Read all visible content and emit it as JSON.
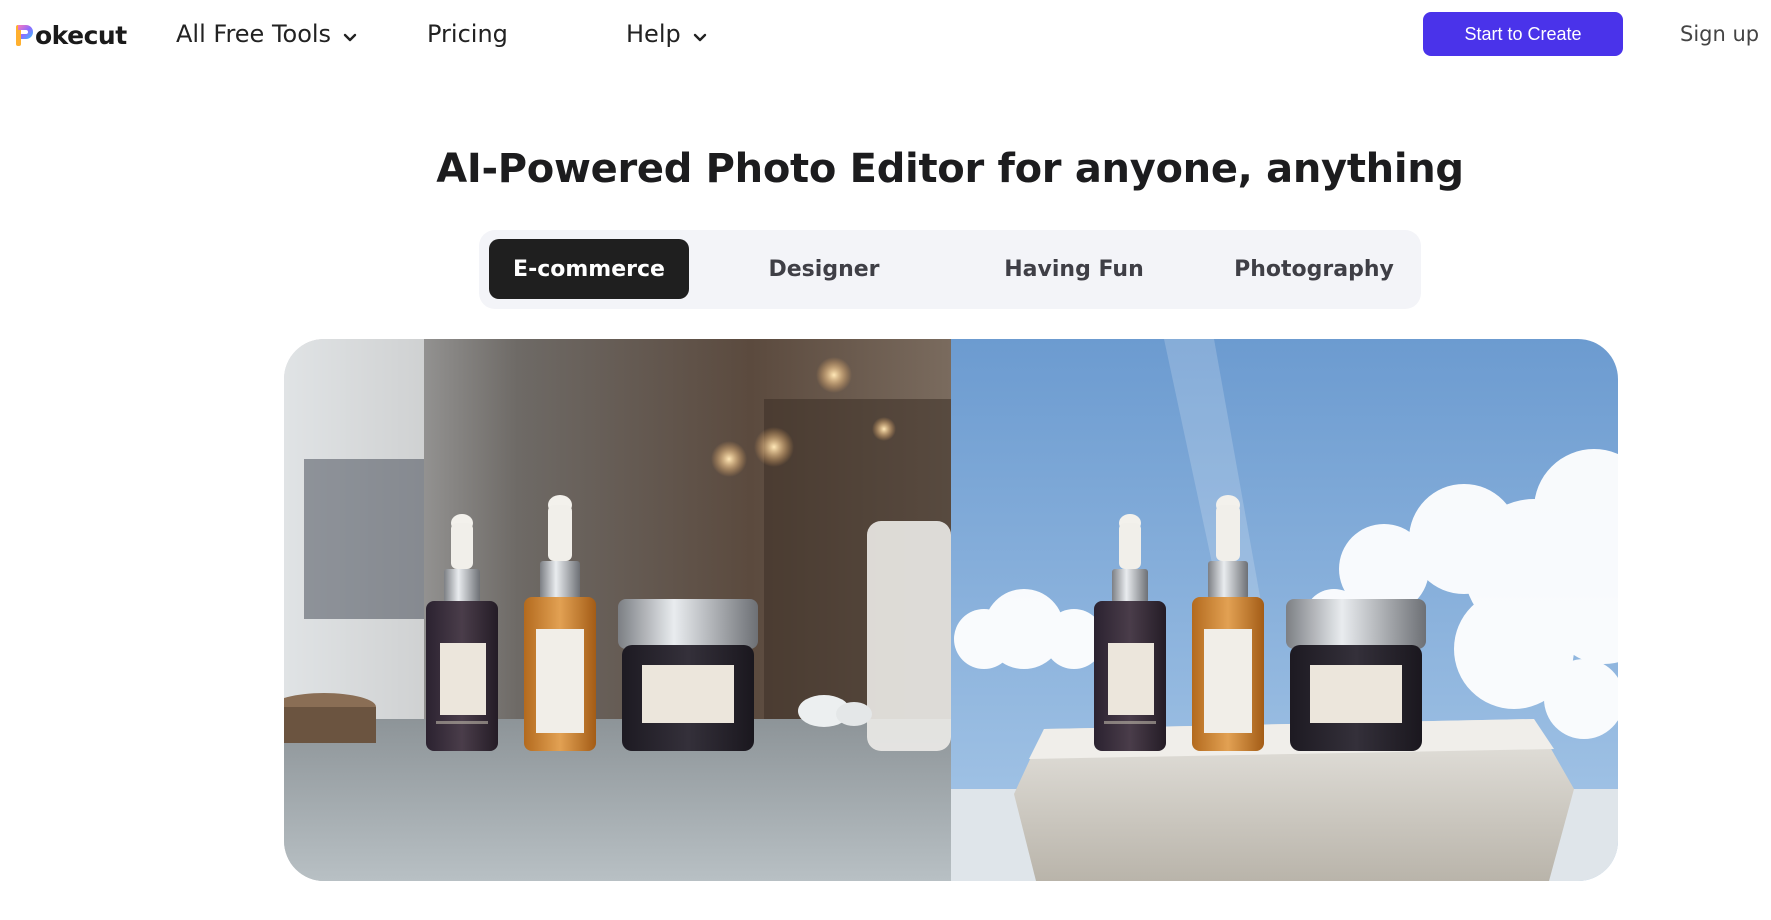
{
  "header": {
    "logo_text": "okecut",
    "nav": [
      {
        "label": "All Free Tools",
        "has_dropdown": true
      },
      {
        "label": "Pricing",
        "has_dropdown": false
      },
      {
        "label": "Help",
        "has_dropdown": true
      }
    ],
    "cta_label": "Start to Create",
    "signup_label": "Sign up"
  },
  "hero": {
    "title": "AI-Powered Photo Editor for anyone, anything",
    "tabs": [
      "E-commerce",
      "Designer",
      "Having Fun",
      "Photography"
    ],
    "active_tab": "E-commerce"
  },
  "colors": {
    "accent": "#4a33ea",
    "tab_active_bg": "#1f1f1f",
    "tab_group_bg": "#f3f4f8"
  },
  "icons": {
    "dropdown": "chevron-down-icon",
    "logo": "pokecut-logo-icon"
  }
}
